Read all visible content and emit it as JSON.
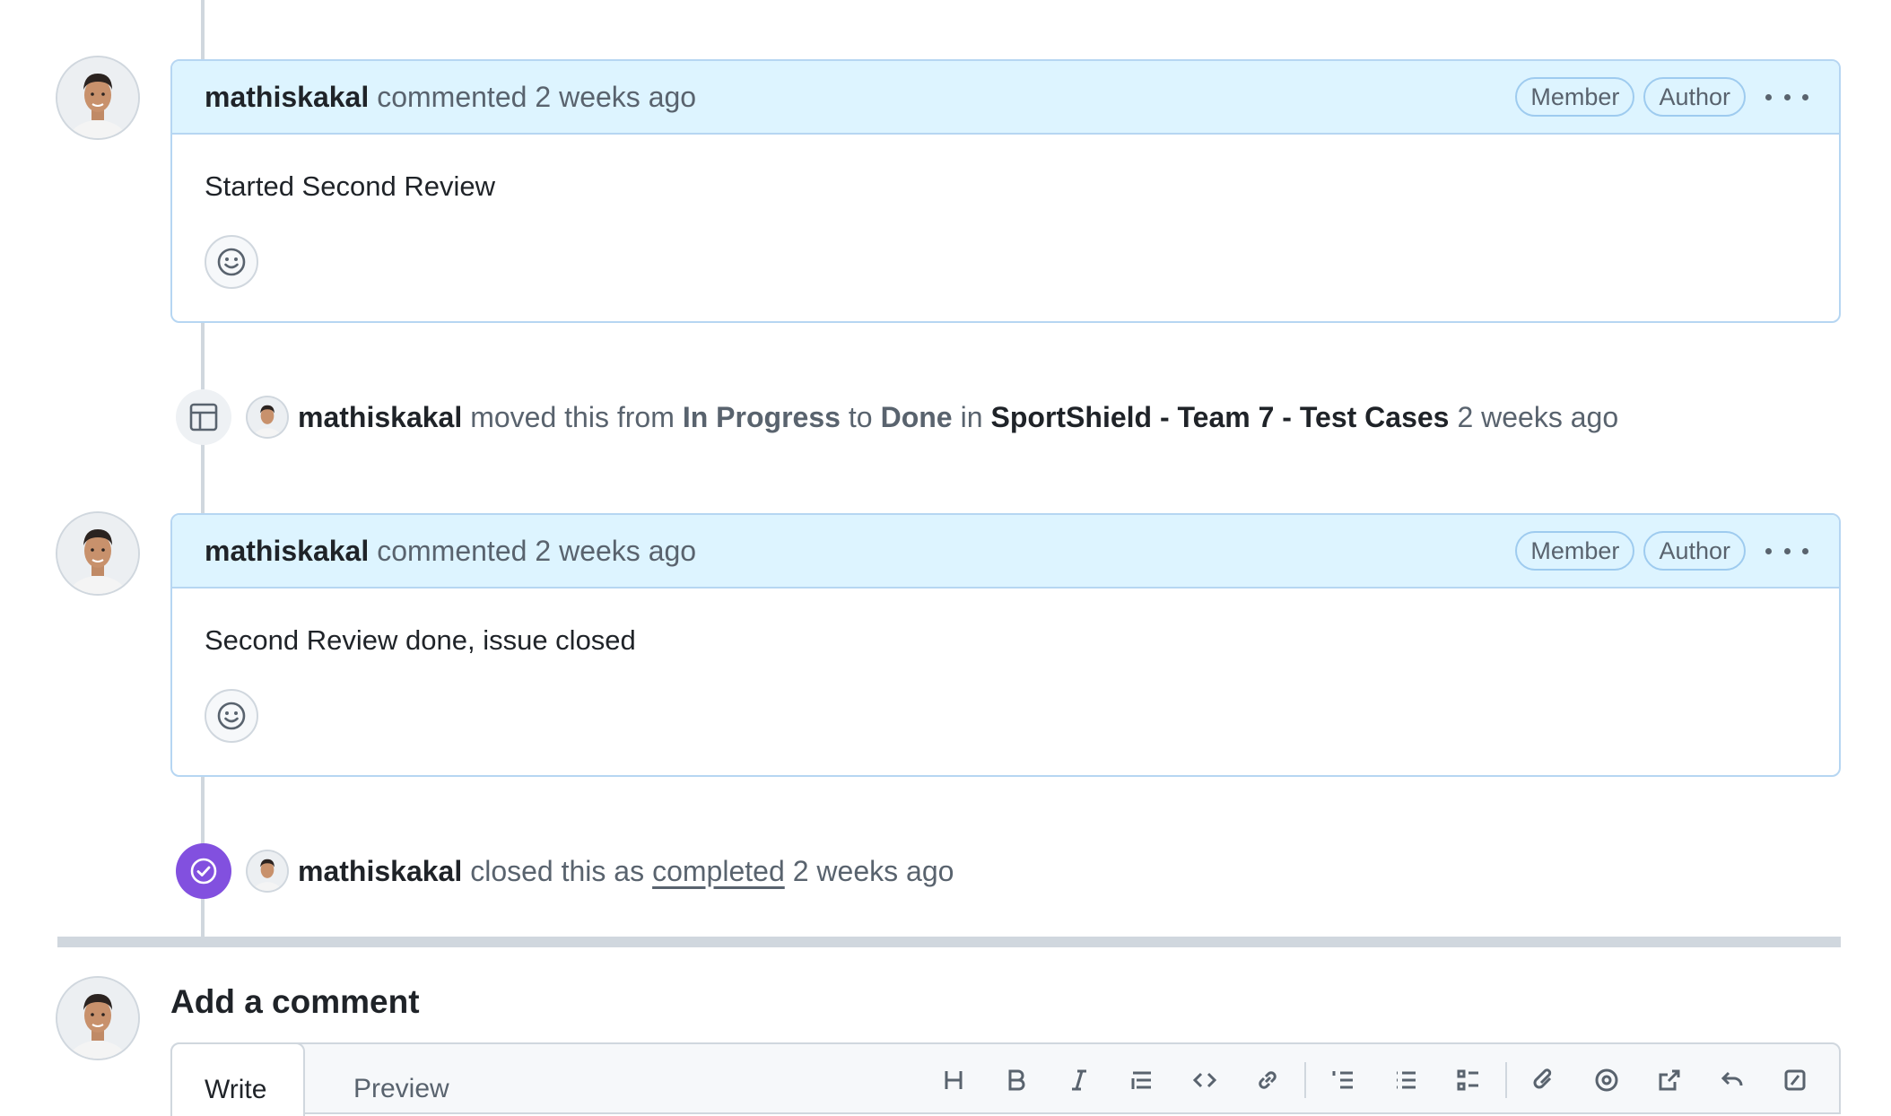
{
  "timeline": [
    {
      "type": "comment",
      "author": "mathiskakal",
      "action": "commented",
      "time": "2 weeks ago",
      "labels": [
        "Member",
        "Author"
      ],
      "body": "Started Second Review"
    },
    {
      "type": "moved",
      "author": "mathiskakal",
      "text_moved": "moved this from",
      "from": "In Progress",
      "text_to": "to",
      "to": "Done",
      "text_in": "in",
      "project": "SportShield - Team 7 - Test Cases",
      "time": "2 weeks ago",
      "icon": "table-icon"
    },
    {
      "type": "comment",
      "author": "mathiskakal",
      "action": "commented",
      "time": "2 weeks ago",
      "labels": [
        "Member",
        "Author"
      ],
      "body": "Second Review done, issue closed"
    },
    {
      "type": "closed",
      "author": "mathiskakal",
      "text_closed": "closed this as",
      "state": "completed",
      "time": "2 weeks ago",
      "icon": "check-circle-icon",
      "badge_color": "#8250df"
    }
  ],
  "add_comment": {
    "title": "Add a comment",
    "tabs": [
      "Write",
      "Preview"
    ],
    "toolbar_icons": [
      "heading-icon",
      "bold-icon",
      "italic-icon",
      "quote-icon",
      "code-icon",
      "link-icon",
      "ordered-list-icon",
      "unordered-list-icon",
      "task-list-icon",
      "attach-icon",
      "mention-icon",
      "cross-reference-icon",
      "reply-icon",
      "slash-command-icon"
    ]
  },
  "colors": {
    "comment_header_bg": "#ddf4ff",
    "comment_border": "#b6d6f2",
    "closed_badge": "#8250df",
    "muted_text": "#59636e"
  }
}
